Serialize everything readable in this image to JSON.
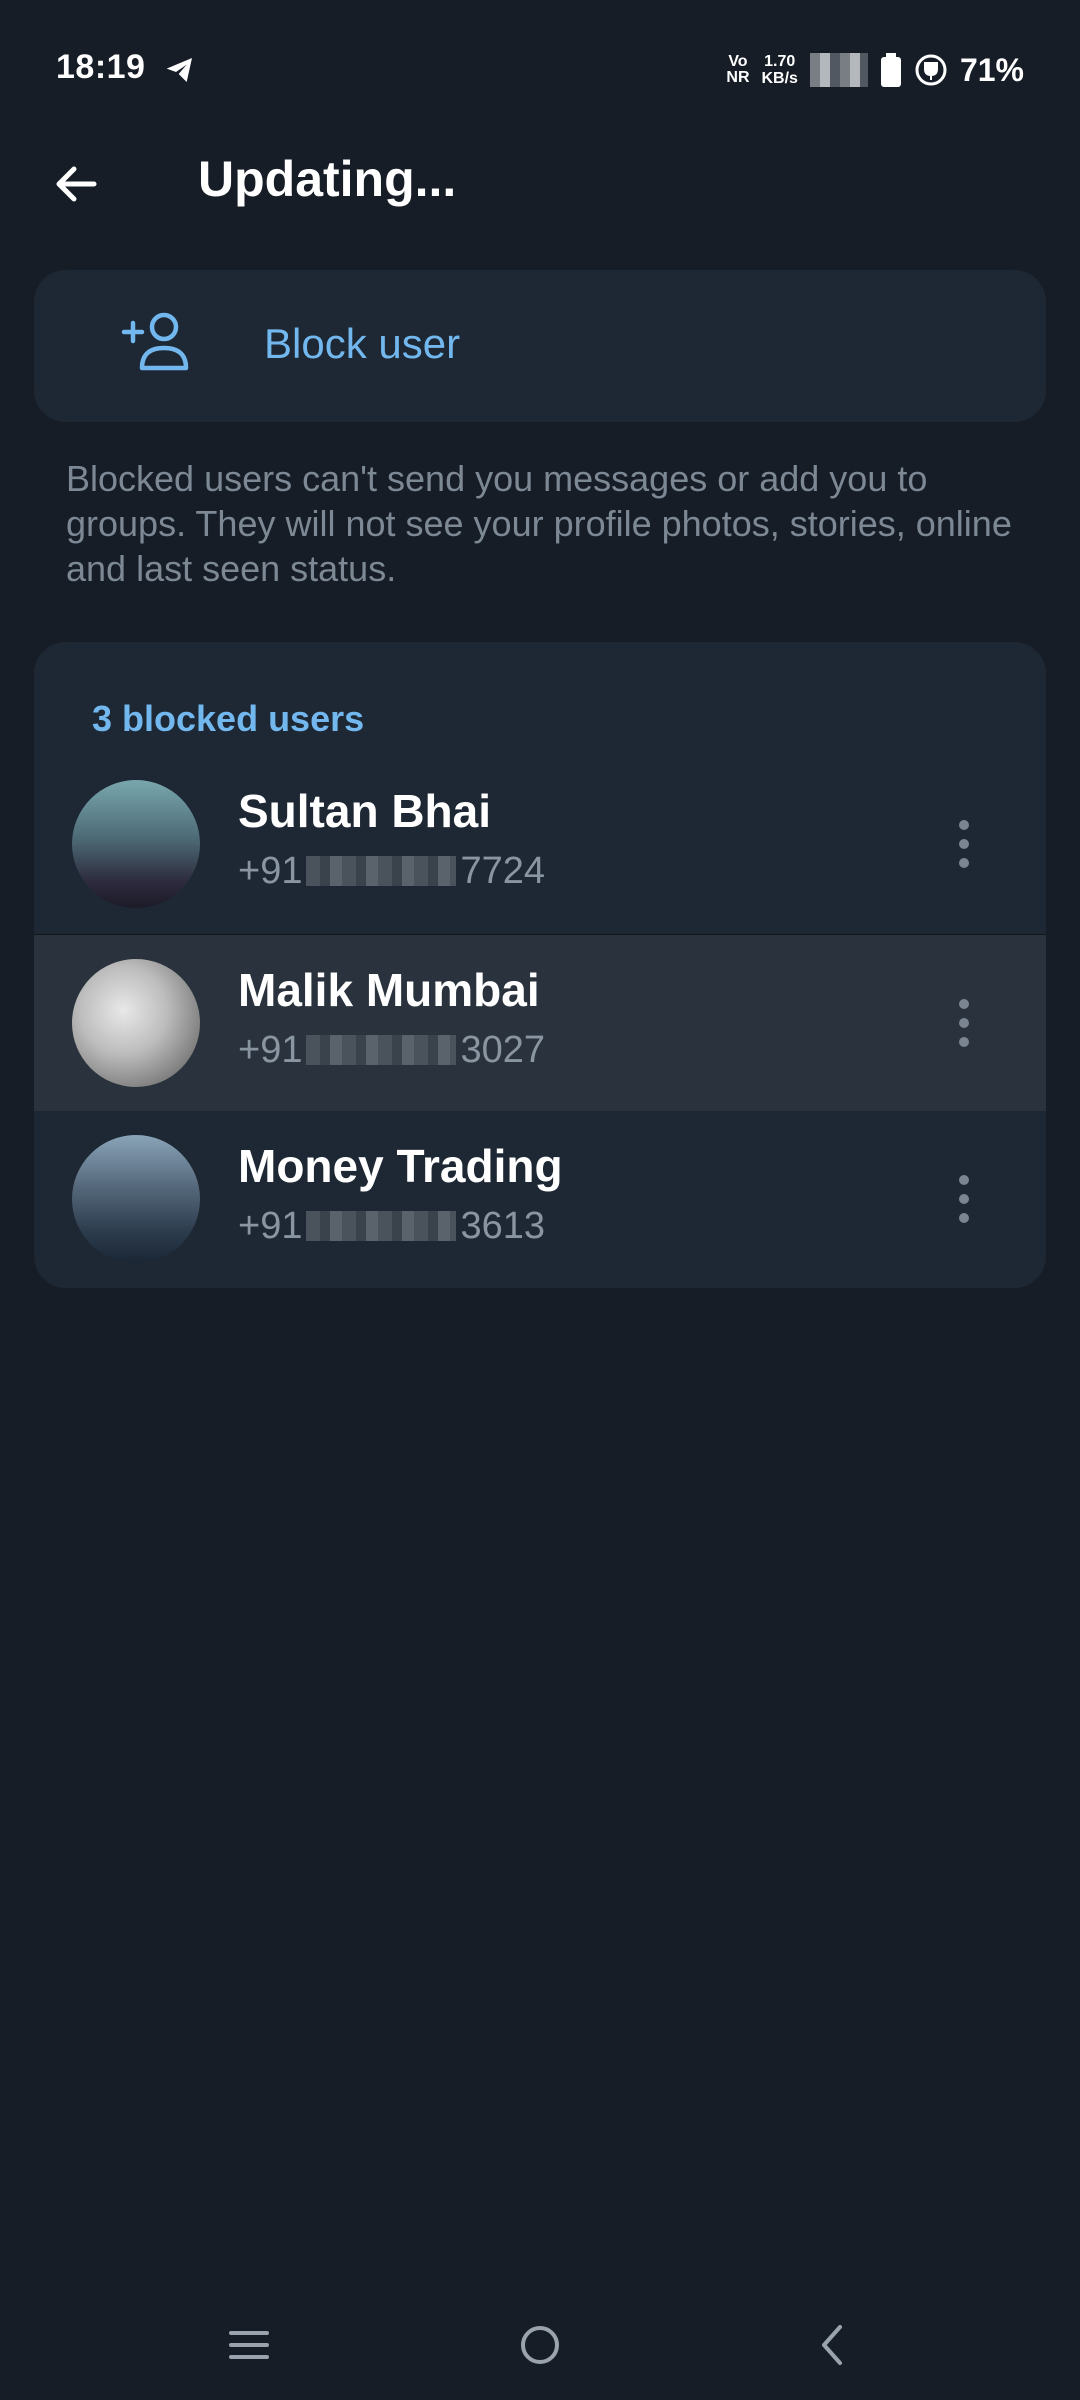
{
  "status_bar": {
    "time": "18:19",
    "volte_line1": "Vo",
    "volte_line2": "NR",
    "netspeed_value": "1.70",
    "netspeed_unit": "KB/s",
    "battery_percent": "71%"
  },
  "header": {
    "title": "Updating..."
  },
  "block_user": {
    "label": "Block user"
  },
  "info_text": "Blocked users can't send you messages or add you to groups. They will not see your profile photos, stories, online and last seen status.",
  "blocked_list": {
    "header": "3 blocked users",
    "users": [
      {
        "name": "Sultan Bhai",
        "phone_prefix": "+91",
        "phone_suffix": "7724"
      },
      {
        "name": "Malik Mumbai",
        "phone_prefix": "+91",
        "phone_suffix": "3027"
      },
      {
        "name": "Money Trading",
        "phone_prefix": "+91",
        "phone_suffix": "3613"
      }
    ]
  },
  "colors": {
    "background": "#171d26",
    "card": "#1e2834",
    "accent": "#72b8ef",
    "secondary_text": "#7d8895"
  }
}
